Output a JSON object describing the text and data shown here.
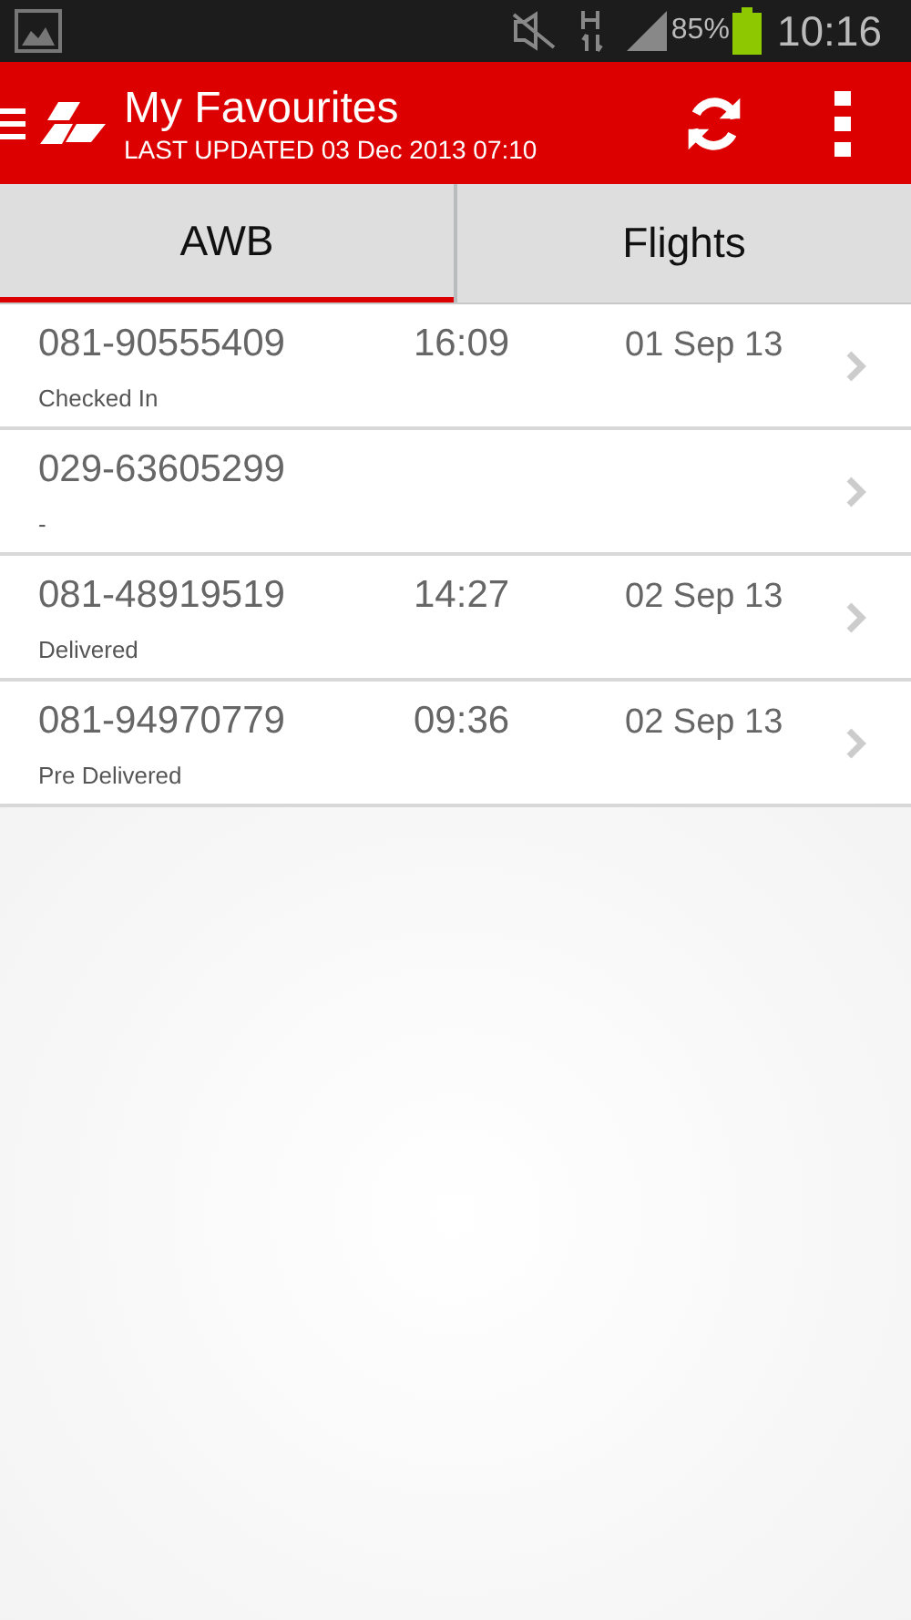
{
  "status_bar": {
    "battery": "85%",
    "time": "10:16"
  },
  "header": {
    "title": "My Favourites",
    "subtitle": "LAST UPDATED 03 Dec 2013 07:10"
  },
  "tabs": [
    {
      "label": "AWB",
      "selected": true
    },
    {
      "label": "Flights",
      "selected": false
    }
  ],
  "rows": [
    {
      "awb": "081-90555409",
      "time": "16:09",
      "date": "01 Sep 13",
      "status": "Checked In"
    },
    {
      "awb": "029-63605299",
      "status": "-"
    },
    {
      "awb": "081-48919519",
      "time": "14:27",
      "date": "02 Sep 13",
      "status": "Delivered"
    },
    {
      "awb": "081-94970779",
      "time": "09:36",
      "date": "02 Sep 13",
      "status": "Pre Delivered"
    }
  ]
}
